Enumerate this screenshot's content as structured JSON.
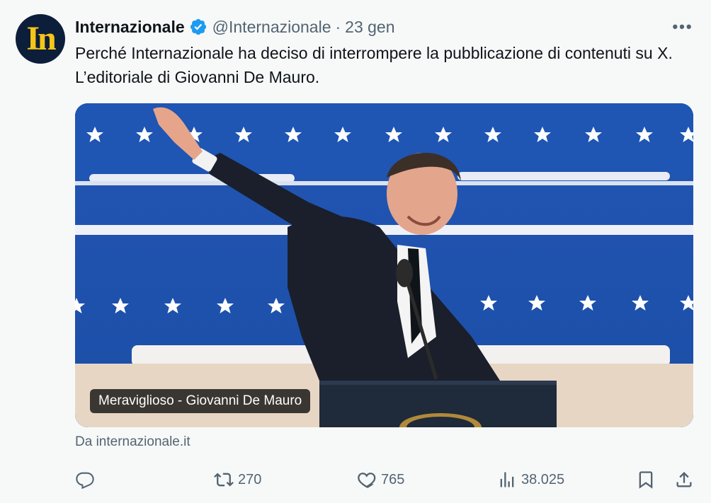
{
  "tweet": {
    "avatar_text": "In",
    "author_name": "Internazionale",
    "handle": "@Internazionale",
    "separator": "·",
    "date": "23 gen",
    "more_label": "•••",
    "text": "Perché Internazionale ha deciso di interrompere la pubblicazione di contenuti su X. L’editoriale di Giovanni De Mauro.",
    "media": {
      "caption": "Meraviglioso - Giovanni De Mauro"
    },
    "source": "Da internazionale.it",
    "stats": {
      "replies": "",
      "retweets": "270",
      "likes": "765",
      "views": "38.025"
    }
  },
  "colors": {
    "accent": "#1d9bf0",
    "text_primary": "#0f1419",
    "text_secondary": "#536471",
    "background": "#f7f9f9"
  },
  "icons": {
    "verified": "verified-badge-icon",
    "more": "more-icon",
    "reply": "reply-icon",
    "retweet": "retweet-icon",
    "like": "heart-icon",
    "views": "views-icon",
    "bookmark": "bookmark-icon",
    "share": "share-icon"
  }
}
